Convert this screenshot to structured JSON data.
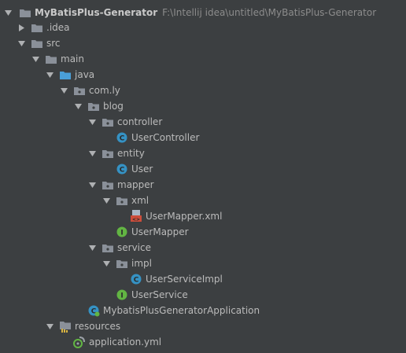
{
  "colors": {
    "background": "#3c3f41",
    "text": "#bbbbbb",
    "path_text": "#8c8c8c",
    "folder": "#8a9099",
    "source_folder": "#4a9fd8",
    "class_icon": "#3592c4",
    "interface_icon": "#62b543",
    "xml_icon": "#cc4d3b"
  },
  "project_tree": {
    "root": {
      "name": "MyBatisPlus-Generator",
      "path": "F:\\Intellij idea\\untitled\\MyBatisPlus-Generator",
      "icon": "folder-icon"
    },
    "nodes": [
      {
        "label": ".idea",
        "icon": "folder-icon",
        "expanded": false
      },
      {
        "label": "src",
        "icon": "folder-icon",
        "expanded": true
      },
      {
        "label": "main",
        "icon": "folder-icon",
        "expanded": true
      },
      {
        "label": "java",
        "icon": "source-folder-icon",
        "expanded": true
      },
      {
        "label": "com.ly",
        "icon": "package-icon",
        "expanded": true
      },
      {
        "label": "blog",
        "icon": "package-icon",
        "expanded": true
      },
      {
        "label": "controller",
        "icon": "package-icon",
        "expanded": true
      },
      {
        "label": "UserController",
        "icon": "class-icon"
      },
      {
        "label": "entity",
        "icon": "package-icon",
        "expanded": true
      },
      {
        "label": "User",
        "icon": "class-icon"
      },
      {
        "label": "mapper",
        "icon": "package-icon",
        "expanded": true
      },
      {
        "label": "xml",
        "icon": "package-icon",
        "expanded": true
      },
      {
        "label": "UserMapper.xml",
        "icon": "xml-file-icon"
      },
      {
        "label": "UserMapper",
        "icon": "interface-icon"
      },
      {
        "label": "service",
        "icon": "package-icon",
        "expanded": true
      },
      {
        "label": "impl",
        "icon": "package-icon",
        "expanded": true
      },
      {
        "label": "UserServiceImpl",
        "icon": "class-icon"
      },
      {
        "label": "UserService",
        "icon": "interface-icon"
      },
      {
        "label": "MybatisPlusGeneratorApplication",
        "icon": "spring-boot-class-icon"
      },
      {
        "label": "resources",
        "icon": "resources-folder-icon",
        "expanded": true
      },
      {
        "label": "application.yml",
        "icon": "yaml-file-icon"
      }
    ]
  }
}
